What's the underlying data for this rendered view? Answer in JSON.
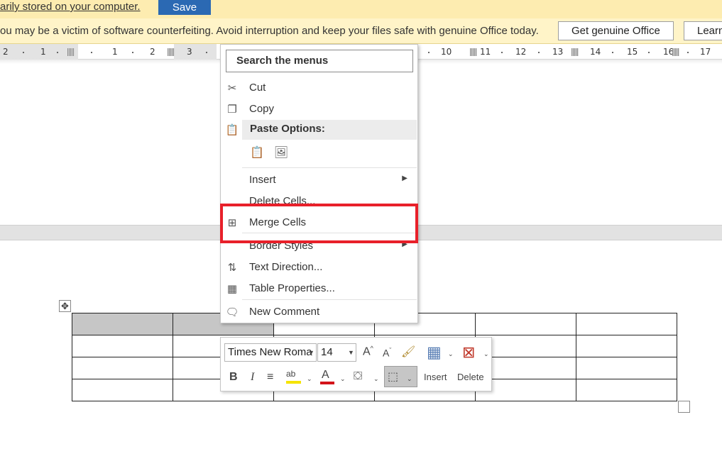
{
  "infobar_save": {
    "text": "arily stored on your computer.",
    "save_label": "Save"
  },
  "infobar_license": {
    "text": "ou may be a victim of software counterfeiting. Avoid interruption and keep your files safe with genuine Office today.",
    "get_genuine_label": "Get genuine Office",
    "learn_label": "Learn"
  },
  "ruler": {
    "ticks": [
      "2",
      "1",
      "1",
      "2",
      "3",
      "10",
      "11",
      "12",
      "13",
      "14",
      "15",
      "16",
      "17"
    ]
  },
  "context_menu": {
    "search_placeholder": "Search the menus",
    "items": {
      "cut": "Cut",
      "copy": "Copy",
      "paste_options": "Paste Options:",
      "insert": "Insert",
      "delete_cells": "Delete Cells...",
      "merge_cells": "Merge Cells",
      "border_styles": "Border Styles",
      "text_direction": "Text Direction...",
      "table_properties": "Table Properties...",
      "new_comment": "New Comment"
    }
  },
  "mini_toolbar": {
    "font_name": "Times New Roma",
    "font_size": "14",
    "insert_label": "Insert",
    "delete_label": "Delete",
    "highlight_color": "#f5e400",
    "font_color": "#d3131a"
  },
  "colors": {
    "save_button": "#2b69b3",
    "highlight_box": "#e8202a",
    "selected_cell": "#c6c6c6"
  }
}
